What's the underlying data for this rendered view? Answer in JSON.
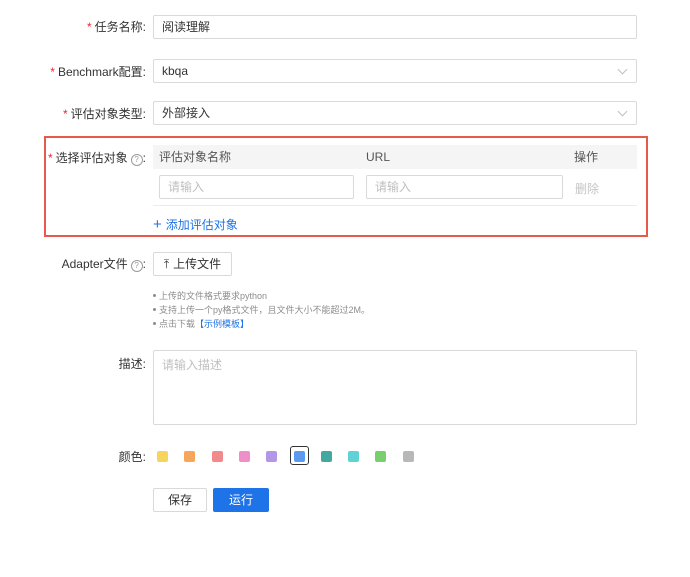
{
  "form": {
    "task_name": {
      "label": "任务名称",
      "value": "阅读理解"
    },
    "benchmark": {
      "label": "Benchmark配置",
      "value": "kbqa"
    },
    "target_type": {
      "label": "评估对象类型",
      "value": "外部接入"
    },
    "targets": {
      "label": "选择评估对象",
      "help": "?",
      "columns": [
        "评估对象名称",
        "URL",
        "操作"
      ],
      "row": {
        "name_placeholder": "请输入",
        "url_placeholder": "请输入",
        "action": "删除"
      },
      "add_label": "添加评估对象",
      "add_icon": "+"
    },
    "adapter": {
      "label": "Adapter文件",
      "help": "?",
      "upload_label": "上传文件",
      "upload_icon": "⤒",
      "hints": [
        "上传的文件格式要求python",
        "支持上传一个py格式文件，且文件大小不能超过2M。"
      ],
      "hint3_prefix": "点击下载",
      "hint3_link": "【示例模板】"
    },
    "description": {
      "label": "描述",
      "placeholder": "请输入描述"
    },
    "color": {
      "label": "颜色",
      "swatches": [
        "#f7d55c",
        "#f5a65b",
        "#f08a8c",
        "#ef8ec9",
        "#b297e6",
        "#5b9bef",
        "#45a8a0",
        "#5fd2d6",
        "#77cf6e",
        "#b8b8b8"
      ],
      "selected_index": 5
    },
    "required_mark": "*",
    "colon": ":",
    "save_label": "保存",
    "run_label": "运行"
  }
}
